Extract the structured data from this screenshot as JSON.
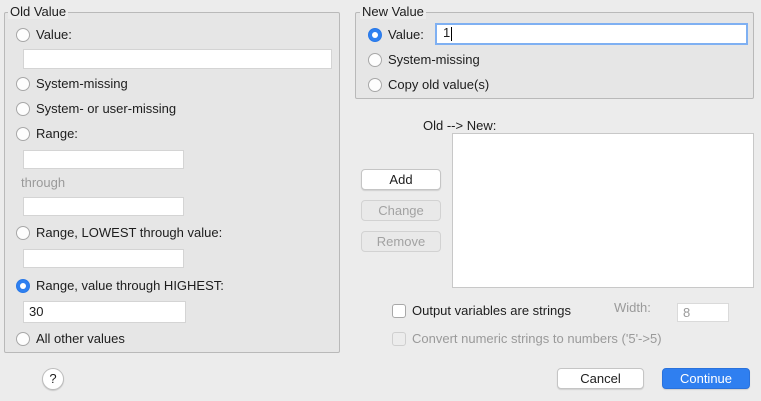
{
  "old_value": {
    "title": "Old Value",
    "value_label": "Value:",
    "value_input": "",
    "system_missing_label": "System-missing",
    "system_or_user_missing_label": "System- or user-missing",
    "range_label": "Range:",
    "range_from_input": "",
    "through_label": "through",
    "range_to_input": "",
    "range_lowest_label": "Range, LOWEST through value:",
    "range_lowest_input": "",
    "range_highest_label": "Range, value through HIGHEST:",
    "range_highest_input": "30",
    "all_other_label": "All other values",
    "selected": "range_highest"
  },
  "new_value": {
    "title": "New Value",
    "value_label": "Value:",
    "value_input": "1",
    "system_missing_label": "System-missing",
    "copy_old_label": "Copy old value(s)",
    "selected": "value"
  },
  "mapping": {
    "header": "Old --> New:",
    "add_label": "Add",
    "change_label": "Change",
    "remove_label": "Remove",
    "items": []
  },
  "options": {
    "output_strings_label": "Output variables are strings",
    "output_strings_checked": false,
    "width_label": "Width:",
    "width_value": "8",
    "convert_numeric_label": "Convert numeric strings to numbers ('5'->5)",
    "convert_numeric_checked": false
  },
  "footer": {
    "help_label": "?",
    "cancel_label": "Cancel",
    "continue_label": "Continue"
  },
  "colors": {
    "accent": "#2f80f0",
    "panel_bg": "#ececec"
  }
}
